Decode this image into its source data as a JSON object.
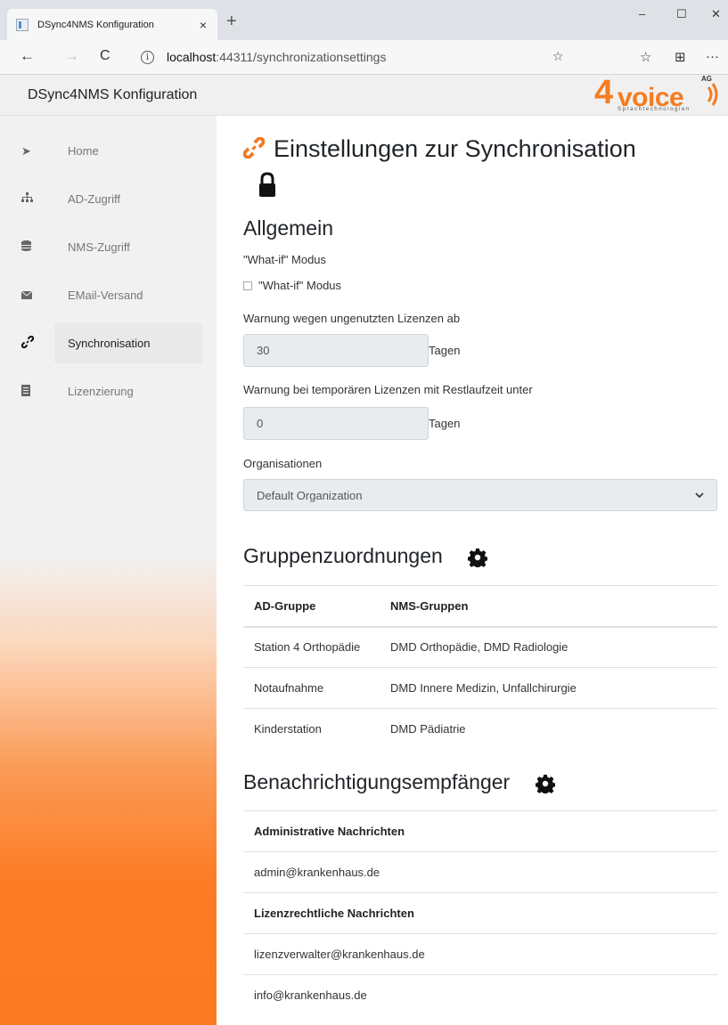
{
  "browser": {
    "tab_title": "DSync4NMS Konfiguration",
    "tab_close": "×",
    "new_tab": "+",
    "url_host": "localhost",
    "url_path": ":44311/synchronizationsettings",
    "info_glyph": "i",
    "window_controls": [
      "–",
      "☐",
      "✕"
    ],
    "nav": {
      "back": "←",
      "forward": "→",
      "refresh": "C"
    },
    "toolbar": {
      "favorites": "☆",
      "collections": "⊞",
      "more": "···"
    }
  },
  "app": {
    "brand": "DSync4NMS Konfiguration",
    "logo": {
      "four": "4",
      "voice": "voice",
      "ag": "AG",
      "subtitle": "Sprachtechnologien"
    }
  },
  "sidebar": {
    "items": [
      {
        "label": "Home",
        "icon": "home-icon"
      },
      {
        "label": "AD-Zugriff",
        "icon": "sitemap-icon"
      },
      {
        "label": "NMS-Zugriff",
        "icon": "database-icon"
      },
      {
        "label": "EMail-Versand",
        "icon": "envelope-icon"
      },
      {
        "label": "Synchronisation",
        "icon": "link-icon",
        "active": true
      },
      {
        "label": "Lizenzierung",
        "icon": "document-icon"
      }
    ]
  },
  "page": {
    "title": "Einstellungen zur Synchronisation",
    "general": {
      "heading": "Allgemein",
      "whatif_label": "\"What-if\" Modus",
      "whatif_checkbox_label": "\"What-if\" Modus",
      "whatif_checked": false,
      "unused_license_label": "Warnung wegen ungenutzten Lizenzen ab",
      "unused_license_value": "30",
      "unused_license_suffix": "Tagen",
      "temp_license_label": "Warnung bei temporären Lizenzen mit Restlaufzeit unter",
      "temp_license_value": "0",
      "temp_license_suffix": "Tagen",
      "org_label": "Organisationen",
      "org_selected": "Default Organization"
    },
    "groups": {
      "heading": "Gruppenzuordnungen",
      "columns": [
        "AD-Gruppe",
        "NMS-Gruppen"
      ],
      "rows": [
        [
          "Station 4 Orthopädie",
          "DMD Orthopädie, DMD Radiologie"
        ],
        [
          "Notaufnahme",
          "DMD Innere Medizin, Unfallchirurgie"
        ],
        [
          "Kinderstation",
          "DMD Pädiatrie"
        ]
      ]
    },
    "recipients": {
      "heading": "Benachrichtigungsempfänger",
      "admin_header": "Administrative Nachrichten",
      "admin_emails": [
        "admin@krankenhaus.de"
      ],
      "license_header": "Lizenzrechtliche Nachrichten",
      "license_emails": [
        "lizenzverwalter@krankenhaus.de",
        "info@krankenhaus.de"
      ]
    }
  },
  "colors": {
    "accent": "#f07a22",
    "sidebar_gradient_end": "#fc7a21"
  }
}
